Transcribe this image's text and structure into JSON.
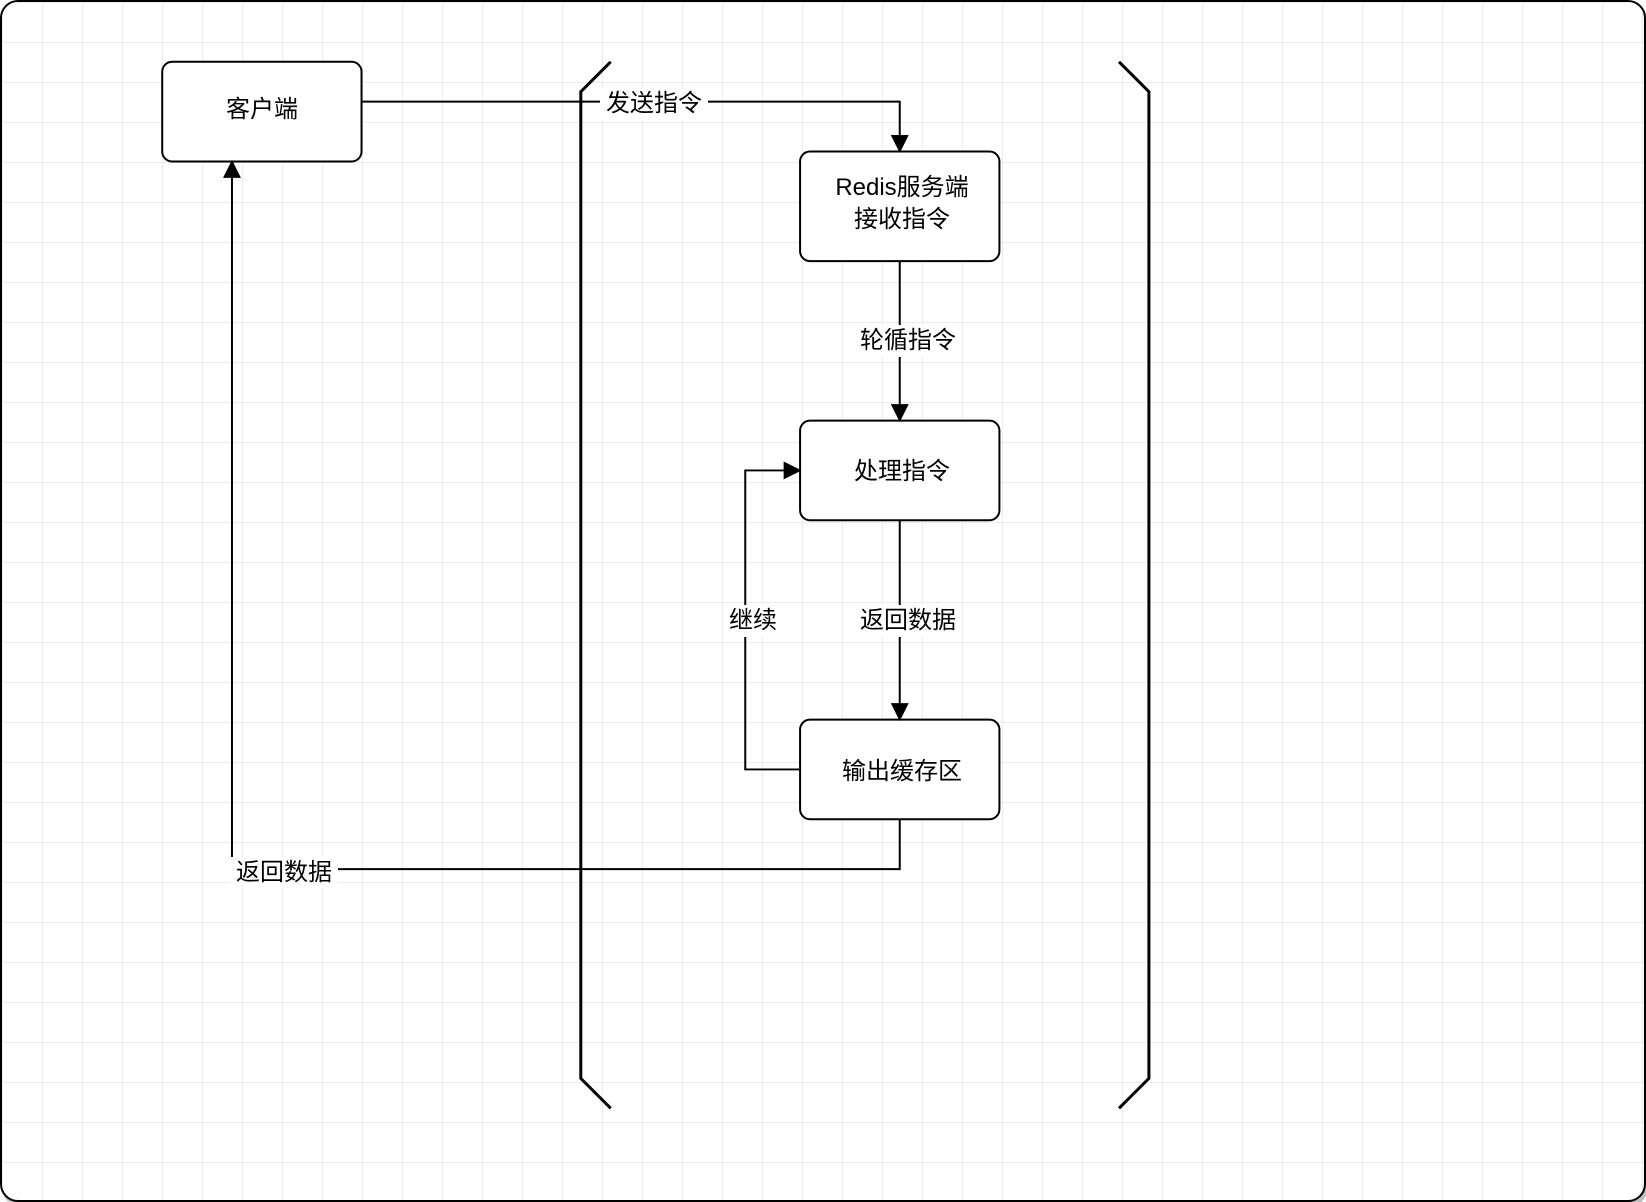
{
  "nodes": {
    "client": "客户端",
    "redis_receive": "Redis服务端\n接收指令",
    "process": "处理指令",
    "buffer": "输出缓存区"
  },
  "edges": {
    "send": "发送指令",
    "poll": "轮循指令",
    "return_data": "返回数据",
    "continue": "继续",
    "return_client": "返回数据"
  }
}
